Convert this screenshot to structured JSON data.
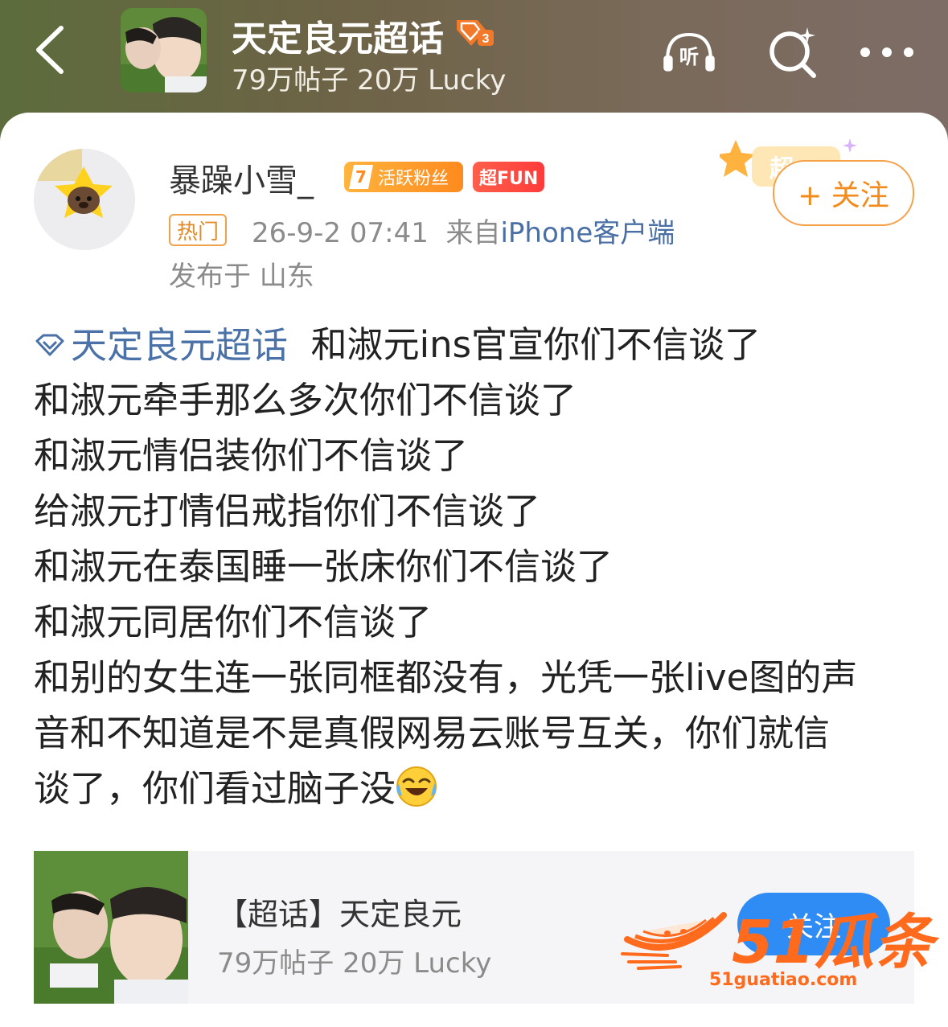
{
  "header": {
    "title": "天定良元超话",
    "level_badge": "3",
    "subtitle": "79万帖子 20万 Lucky",
    "icons": [
      "back-arrow-icon",
      "listen-icon",
      "search-icon",
      "more-icon"
    ],
    "listen_label": "听"
  },
  "post": {
    "username": "暴躁小雪_",
    "fan_level": "7",
    "fan_badge_label": "活跃粉丝",
    "super_badge_label": "超FUN",
    "hot_label": "热门",
    "timestamp": "26-9-2 07:41",
    "source_prefix": "来自",
    "source_device": "iPhone客户端",
    "location": "发布于 山东",
    "follow_label": "+ 关注",
    "deco_label": "超",
    "content": {
      "topic": "天定良元超话",
      "first_line_rest": "和淑元ins官宣你们不信谈了",
      "lines": [
        "和淑元牵手那么多次你们不信谈了",
        "和淑元情侣装你们不信谈了",
        "给淑元打情侣戒指你们不信谈了",
        "和淑元在泰国睡一张床你们不信谈了",
        "和淑元同居你们不信谈了",
        "和别的女生连一张同框都没有，光凭一张live图的声",
        "音和不知道是不是真假网易云账号互关，你们就信"
      ],
      "last_line": "谈了，你们看过脑子没",
      "emoji": "laughing-crying-emoji"
    }
  },
  "link_card": {
    "title": "【超话】天定良元",
    "subtitle": "79万帖子 20万 Lucky",
    "button_label": "关注"
  },
  "watermark": {
    "number": "51",
    "brand": "瓜条",
    "url": "51guatiao.com"
  },
  "colors": {
    "accent_orange": "#f28a1c",
    "topic_blue": "#4a72a8",
    "header_bg": "#6d6346",
    "button_blue": "#2f8cf5"
  }
}
